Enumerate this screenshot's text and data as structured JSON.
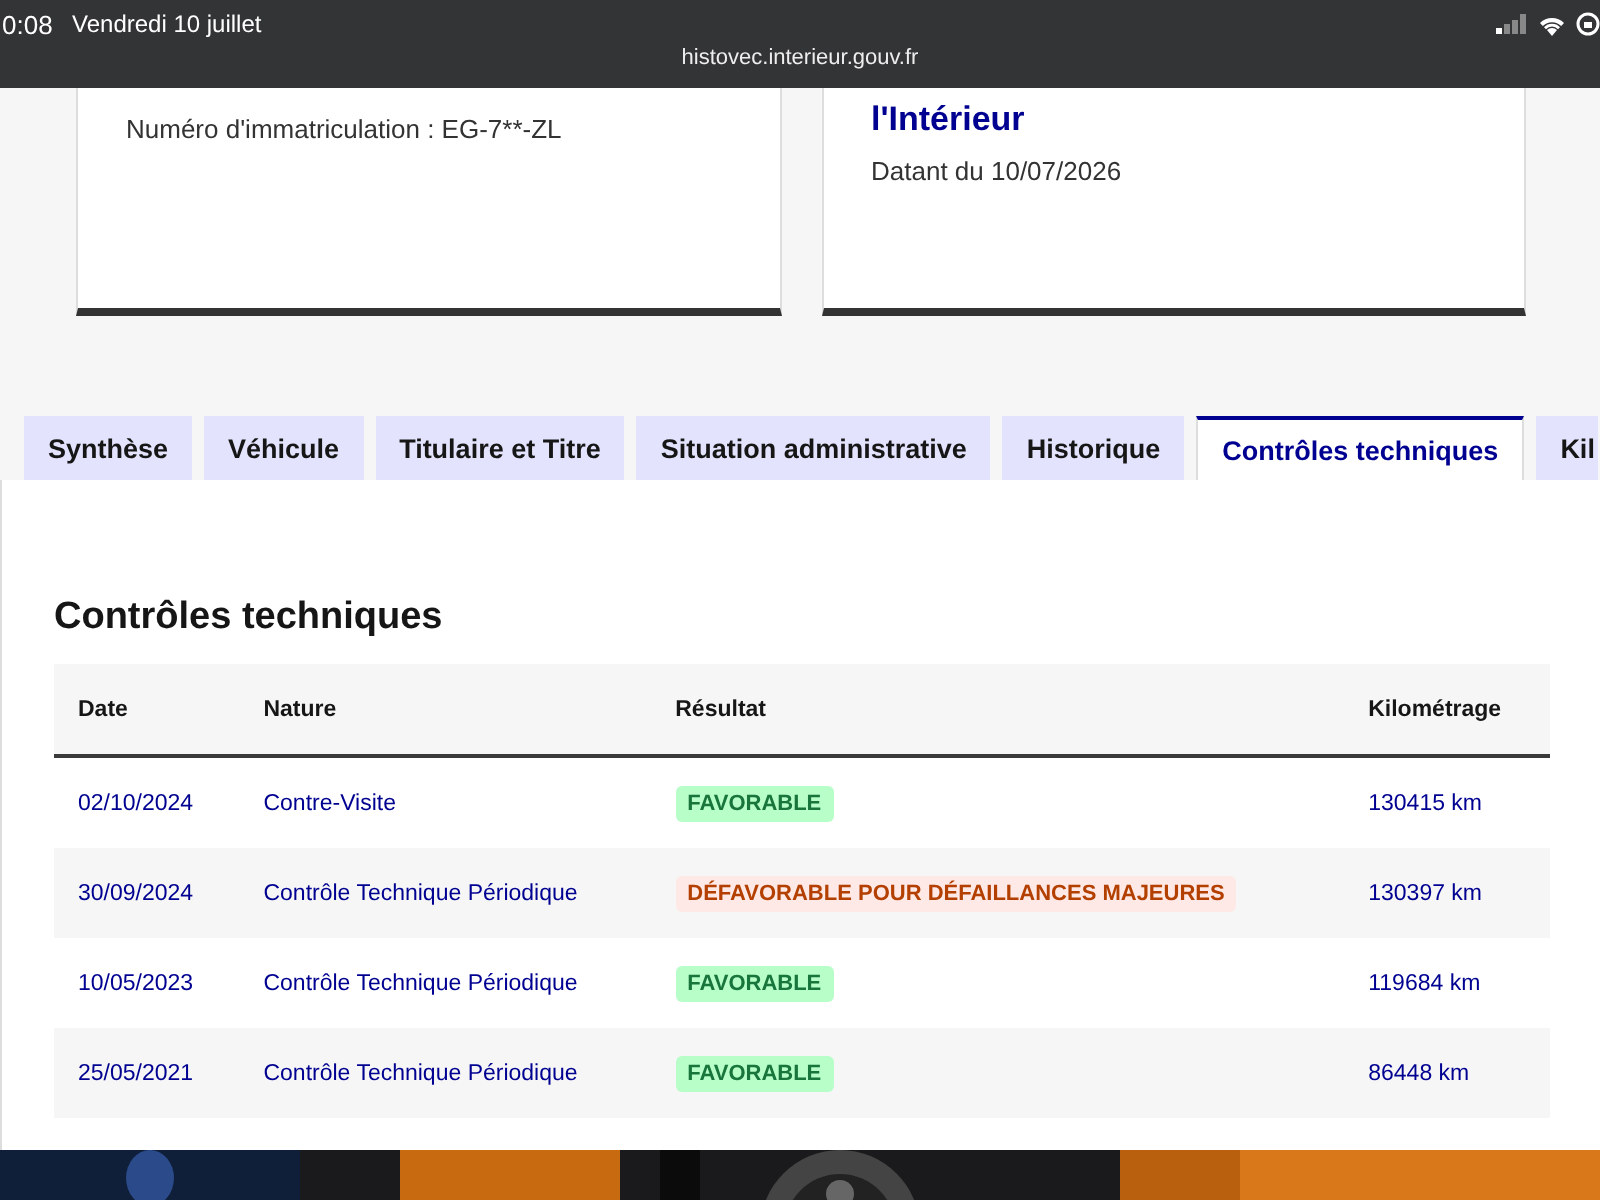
{
  "status_bar": {
    "time": "0:08",
    "date": "Vendredi 10 juillet",
    "url": "histovec.interieur.gouv.fr"
  },
  "cards": [
    {
      "lines": [
        "Numéro d'immatriculation : EG-7**-ZL"
      ]
    },
    {
      "title": "l'Intérieur",
      "lines": [
        "Datant du 10/07/2026"
      ]
    }
  ],
  "tabs": [
    {
      "label": "Synthèse",
      "selected": false
    },
    {
      "label": "Véhicule",
      "selected": false
    },
    {
      "label": "Titulaire et Titre",
      "selected": false
    },
    {
      "label": "Situation administrative",
      "selected": false
    },
    {
      "label": "Historique",
      "selected": false
    },
    {
      "label": "Contrôles techniques",
      "selected": true
    },
    {
      "label": "Kil",
      "selected": false
    }
  ],
  "heading": "Contrôles techniques",
  "table": {
    "columns": [
      "Date",
      "Nature",
      "Résultat",
      "Kilométrage"
    ],
    "rows": [
      {
        "date": "02/10/2024",
        "nature": "Contre-Visite",
        "result": {
          "text": "FAVORABLE",
          "kind": "favorable"
        },
        "km": "130415 km"
      },
      {
        "date": "30/09/2024",
        "nature": "Contrôle Technique Périodique",
        "result": {
          "text": "DÉFAVORABLE POUR DÉFAILLANCES MAJEURES",
          "kind": "defavorable"
        },
        "km": "130397 km"
      },
      {
        "date": "10/05/2023",
        "nature": "Contrôle Technique Périodique",
        "result": {
          "text": "FAVORABLE",
          "kind": "favorable"
        },
        "km": "119684 km"
      },
      {
        "date": "25/05/2021",
        "nature": "Contrôle Technique Périodique",
        "result": {
          "text": "FAVORABLE",
          "kind": "favorable"
        },
        "km": "86448 km"
      }
    ]
  }
}
